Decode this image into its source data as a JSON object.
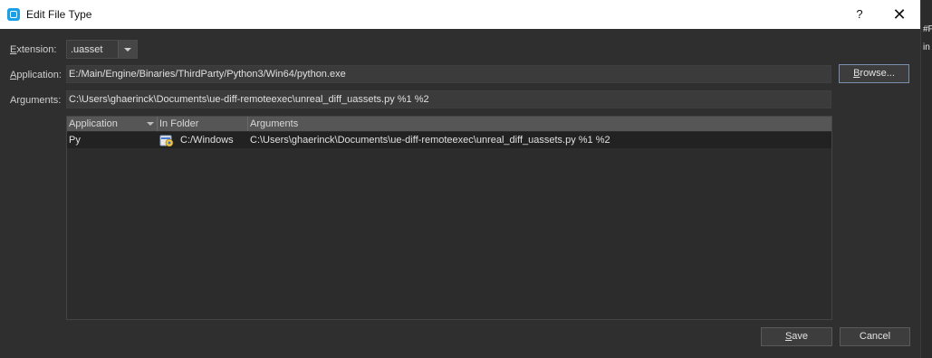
{
  "window": {
    "title": "Edit File Type",
    "help": "?",
    "close": "✕"
  },
  "extension": {
    "label_pre": "",
    "label_u": "E",
    "label_post": "xtension:",
    "value": ".uasset"
  },
  "application": {
    "label_pre": "",
    "label_u": "A",
    "label_post": "pplication:",
    "value": "E:/Main/Engine/Binaries/ThirdParty/Python3/Win64/python.exe"
  },
  "arguments": {
    "label_pre": "Ar",
    "label_u": "g",
    "label_post": "uments:",
    "value": "C:\\Users\\ghaerinck\\Documents\\ue-diff-remoteexec\\unreal_diff_uassets.py %1 %2"
  },
  "buttons": {
    "browse_pre": "",
    "browse_u": "B",
    "browse_post": "rowse...",
    "save_pre": "",
    "save_u": "S",
    "save_post": "ave",
    "cancel": "Cancel"
  },
  "table": {
    "columns": [
      "Application",
      "In Folder",
      "Arguments"
    ],
    "rows": [
      {
        "application": "Py",
        "folder": "C:/Windows",
        "arguments": "C:\\Users\\ghaerinck\\Documents\\ue-diff-remoteexec\\unreal_diff_uassets.py %1 %2"
      }
    ]
  },
  "background_window": {
    "text1": "#F",
    "text2": "in"
  }
}
